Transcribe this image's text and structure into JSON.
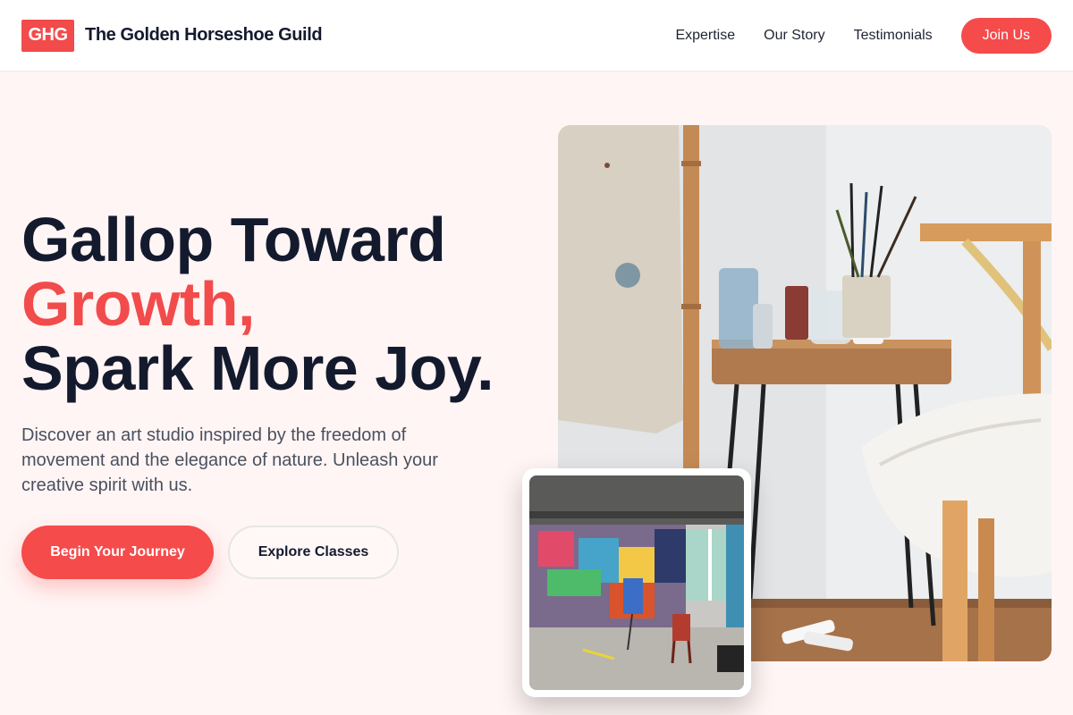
{
  "nav": {
    "logo_text": "GHG",
    "brand_name": "The Golden Horseshoe Guild",
    "links": [
      "Expertise",
      "Our Story",
      "Testimonials"
    ],
    "cta_label": "Join Us"
  },
  "hero": {
    "title_line1": "Gallop Toward",
    "title_accent": "Growth,",
    "title_line3": "Spark More Joy.",
    "description": "Discover an art studio inspired by the freedom of movement and the elegance of nature. Unleash your creative spirit with us.",
    "primary_button": "Begin Your Journey",
    "secondary_button": "Explore Classes"
  },
  "colors": {
    "accent": "#f24b4b",
    "heading": "#141a2e",
    "background": "#fff5f4"
  }
}
